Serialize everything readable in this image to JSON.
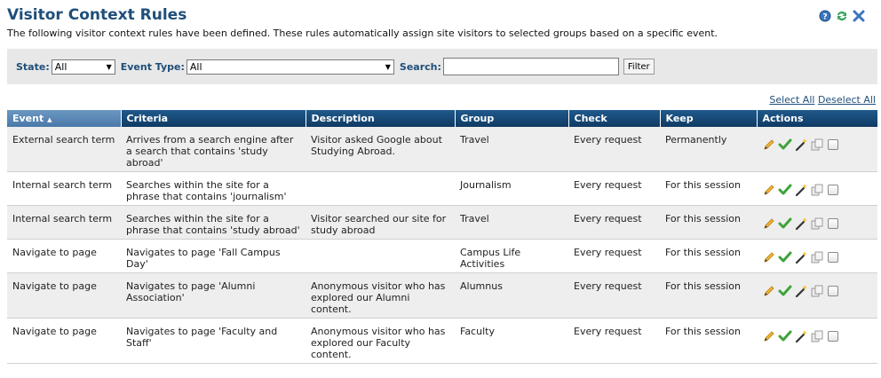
{
  "page": {
    "title": "Visitor Context Rules",
    "subtitle": "The following visitor context rules have been defined. These rules automatically assign site visitors to selected groups based on a specific event."
  },
  "toolbar_icons": [
    "help-icon",
    "refresh-icon",
    "close-icon"
  ],
  "filters": {
    "state_label": "State:",
    "state_value": "All",
    "event_type_label": "Event Type:",
    "event_type_value": "All",
    "search_label": "Search:",
    "search_value": "",
    "filter_button": "Filter"
  },
  "selection": {
    "select_all": "Select All",
    "deselect_all": "Deselect All"
  },
  "table": {
    "columns": [
      "Event",
      "Criteria",
      "Description",
      "Group",
      "Check",
      "Keep",
      "Actions"
    ],
    "sort_indicator": "▲",
    "rows": [
      {
        "event": "External search term",
        "criteria": "Arrives from a search engine after a search that contains 'study abroad'",
        "description": "Visitor asked Google about Studying Abroad.",
        "group": "Travel",
        "check": "Every request",
        "keep": "Permanently"
      },
      {
        "event": "Internal search term",
        "criteria": "Searches within the site for a phrase that contains 'journalism'",
        "description": "",
        "group": "Journalism",
        "check": "Every request",
        "keep": "For this session"
      },
      {
        "event": "Internal search term",
        "criteria": "Searches within the site for a phrase that contains 'study abroad'",
        "description": "Visitor searched our site for study abroad",
        "group": "Travel",
        "check": "Every request",
        "keep": "For this session"
      },
      {
        "event": "Navigate to page",
        "criteria": "Navigates to page 'Fall Campus Day'",
        "description": "",
        "group": "Campus Life Activities",
        "check": "Every request",
        "keep": "For this session"
      },
      {
        "event": "Navigate to page",
        "criteria": "Navigates to page 'Alumni Association'",
        "description": "Anonymous visitor who has explored our Alumni content.",
        "group": "Alumnus",
        "check": "Every request",
        "keep": "For this session"
      },
      {
        "event": "Navigate to page",
        "criteria": "Navigates to page 'Faculty and Staff'",
        "description": "Anonymous visitor who has explored our Faculty content.",
        "group": "Faculty",
        "check": "Every request",
        "keep": "For this session"
      }
    ]
  },
  "row_actions": [
    "edit-icon",
    "enable-icon",
    "wizard-icon",
    "copy-icon",
    "select-checkbox"
  ]
}
